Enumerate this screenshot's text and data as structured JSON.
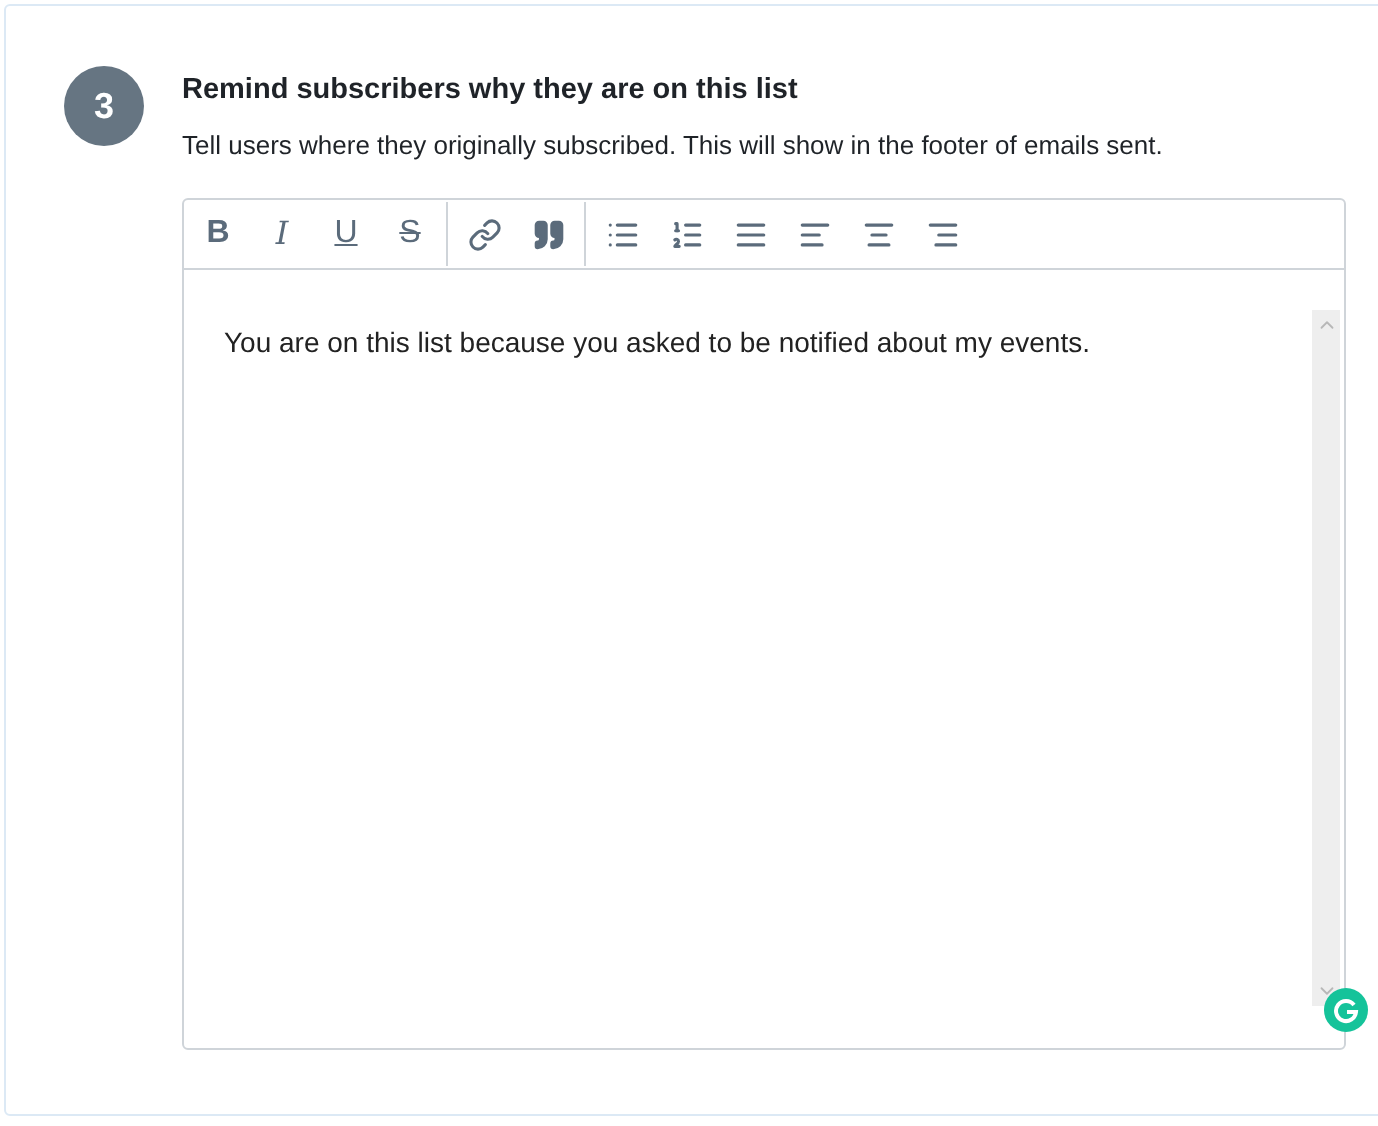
{
  "step": {
    "number": "3",
    "title": "Remind subscribers why they are on this list",
    "description": "Tell users where they originally subscribed. This will show in the footer of emails sent."
  },
  "toolbar": [
    [
      {
        "kind": "bold",
        "label": "B"
      },
      {
        "kind": "italic",
        "label": "I"
      },
      {
        "kind": "underline",
        "label": "U"
      },
      {
        "kind": "strike",
        "label": "S"
      }
    ],
    [
      {
        "kind": "link"
      },
      {
        "kind": "quote"
      }
    ],
    [
      {
        "kind": "bullets"
      },
      {
        "kind": "numbers"
      },
      {
        "kind": "justify"
      },
      {
        "kind": "left"
      },
      {
        "kind": "center"
      },
      {
        "kind": "right"
      }
    ]
  ],
  "editor": {
    "value": "You are on this list because you asked to be notified about my events."
  }
}
